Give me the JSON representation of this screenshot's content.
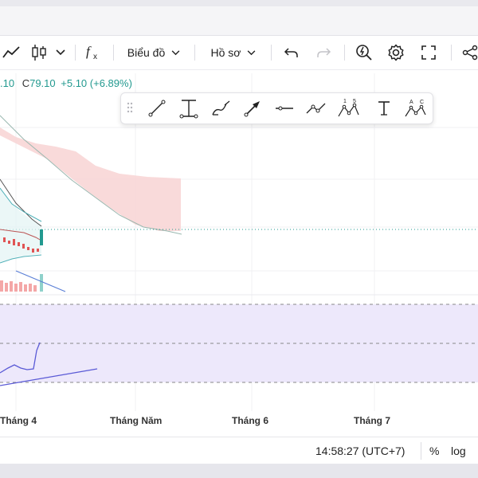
{
  "toolbar": {
    "chart_menu_label": "Biểu đồ",
    "profile_menu_label": "Hồ sơ"
  },
  "legend": {
    "open_tail": ".10",
    "close_label": "C",
    "close_value": "79.10",
    "change": "+5.10",
    "change_percent": "(+6.89%)"
  },
  "drawing_tools": [
    "trend-line",
    "vertical-range",
    "brush",
    "arrow",
    "horizontal-line",
    "polyline",
    "xabcd-pattern",
    "text",
    "abcd-pattern"
  ],
  "drawing_tool_labels": {
    "xabcd_top": [
      "1",
      "5"
    ],
    "abcd_top": [
      "A",
      "C"
    ]
  },
  "x_axis": {
    "labels": [
      "Tháng 4",
      "Tháng Năm",
      "Tháng 6",
      "Tháng 7"
    ]
  },
  "statusbar": {
    "time": "14:58:27 (UTC+7)",
    "percent_label": "%",
    "log_label": "log"
  },
  "colors": {
    "up": "#22998f",
    "down": "#e05454",
    "cloud": "#f8d3d3",
    "rsi_band": "#ede8fb",
    "rsi_line": "#5a5ad6"
  }
}
